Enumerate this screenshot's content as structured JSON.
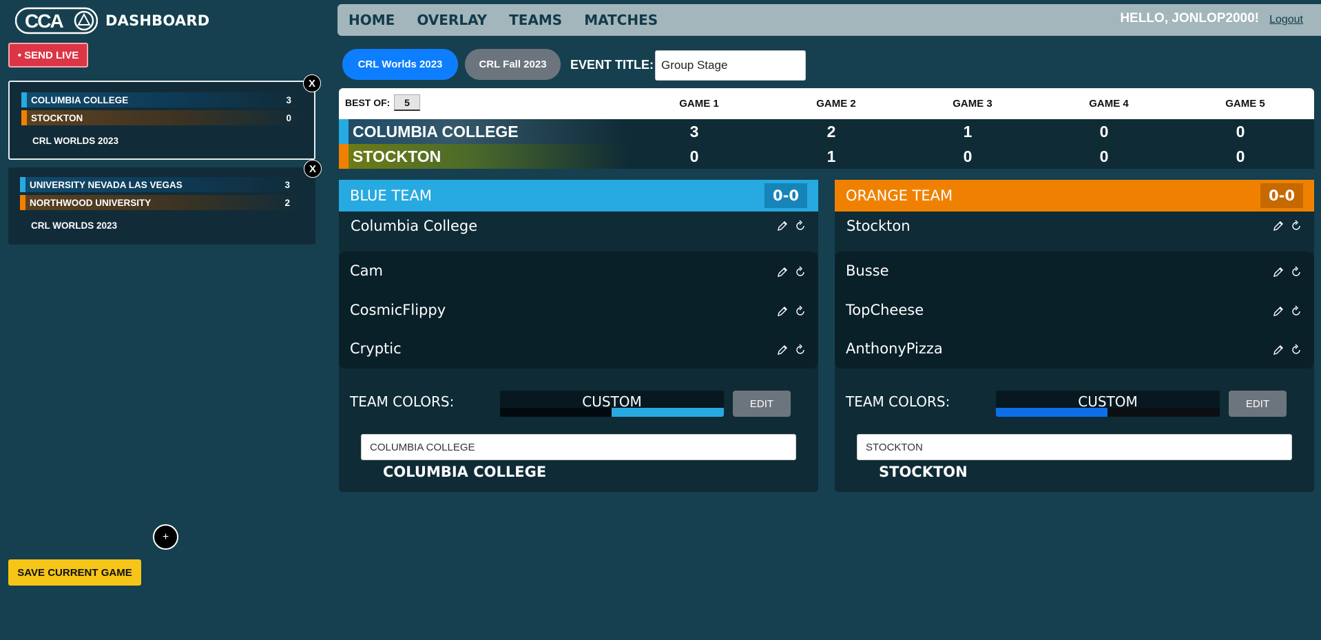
{
  "app": {
    "title": "DASHBOARD",
    "logo_text": "CCA"
  },
  "sidebar": {
    "send_live": "• SEND LIVE",
    "matches": [
      {
        "team1": "COLUMBIA COLLEGE",
        "score1": "3",
        "team2": "STOCKTON",
        "score2": "0",
        "event": "CRL WORLDS 2023",
        "close": "X"
      },
      {
        "team1": "UNIVERSITY NEVADA LAS VEGAS",
        "score1": "3",
        "team2": "NORTHWOOD UNIVERSITY",
        "score2": "2",
        "event": "CRL WORLDS 2023",
        "close": "X"
      }
    ],
    "add_label": "+",
    "save_label": "SAVE CURRENT GAME"
  },
  "nav": {
    "items": [
      "HOME",
      "OVERLAY",
      "TEAMS",
      "MATCHES"
    ],
    "hello": "HELLO, JONLOP2000!",
    "logout": "Logout"
  },
  "event": {
    "tabs": [
      "CRL Worlds 2023",
      "CRL Fall 2023"
    ],
    "title_label": "EVENT TITLE:",
    "title_value": "Group Stage"
  },
  "series": {
    "best_of_label": "BEST OF:",
    "best_of": "5",
    "games": [
      "GAME 1",
      "GAME 2",
      "GAME 3",
      "GAME 4",
      "GAME 5"
    ],
    "teams": [
      {
        "name": "COLUMBIA COLLEGE",
        "scores": [
          "3",
          "2",
          "1",
          "0",
          "0"
        ]
      },
      {
        "name": "STOCKTON",
        "scores": [
          "0",
          "1",
          "0",
          "0",
          "0"
        ]
      }
    ]
  },
  "blue": {
    "header": "BLUE TEAM",
    "score": "0-0",
    "team_name": "Columbia College",
    "players": [
      "Cam",
      "CosmicFlippy",
      "Cryptic"
    ],
    "colors_label": "TEAM COLORS:",
    "colors_preset": "CUSTOM",
    "edit_label": "EDIT",
    "name_input": "COLUMBIA COLLEGE",
    "name_preview": "COLUMBIA COLLEGE"
  },
  "orange": {
    "header": "ORANGE TEAM",
    "score": "0-0",
    "team_name": "Stockton",
    "players": [
      "Busse",
      "TopCheese",
      "AnthonyPizza"
    ],
    "colors_label": "TEAM COLORS:",
    "colors_preset": "CUSTOM",
    "edit_label": "EDIT",
    "name_input": "STOCKTON",
    "name_preview": "STOCKTON"
  },
  "colors": {
    "background": "#16404f",
    "blue": "#27a9e1",
    "orange": "#f08100",
    "primary": "#0d7eff",
    "danger": "#dc3545",
    "warning": "#f5c518"
  }
}
